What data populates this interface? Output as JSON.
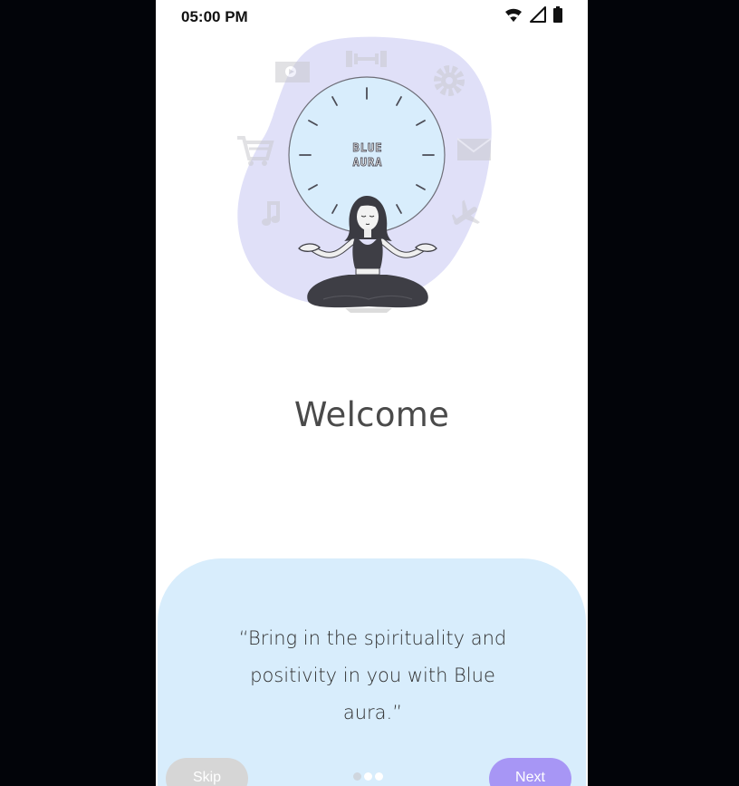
{
  "status_bar": {
    "time": "05:00 PM",
    "icons": [
      "wifi-icon",
      "cellular-signal-icon",
      "battery-icon"
    ]
  },
  "hero": {
    "clock_text_line1": "BLUE",
    "clock_text_line2": "AURA",
    "icons": [
      "video-icon",
      "dumbbell-icon",
      "gear-icon",
      "cart-icon",
      "mail-icon",
      "music-note-icon",
      "airplane-icon"
    ]
  },
  "welcome": {
    "title": "Welcome"
  },
  "card": {
    "quote_line1": "“Bring in the spirituality and",
    "quote_line2": "positivity in you with Blue",
    "quote_line3": "aura.”"
  },
  "footer": {
    "skip_label": "Skip",
    "next_label": "Next",
    "page_count": 3,
    "active_page": 2
  },
  "colors": {
    "blob": "#e0e0f8",
    "clock_face": "#d8edfc",
    "card_bg": "#d8edfc",
    "next_button": "#a796f5",
    "skip_button": "#d6d6d6"
  }
}
